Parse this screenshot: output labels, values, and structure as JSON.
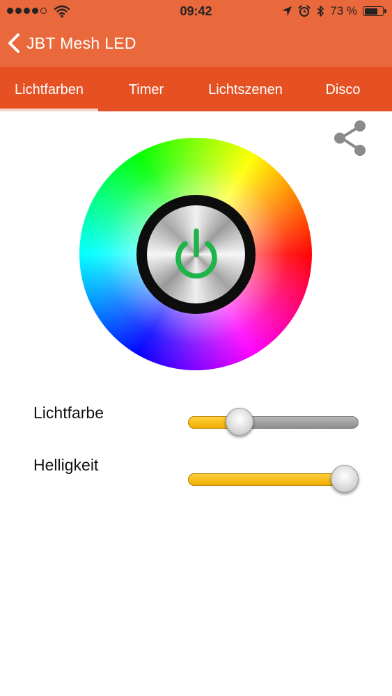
{
  "status": {
    "time": "09:42",
    "battery": "73 %",
    "battery_level": 0.73
  },
  "nav": {
    "title": "JBT Mesh LED"
  },
  "tabs": [
    {
      "label": "Lichtfarben",
      "selected": true
    },
    {
      "label": "Timer",
      "selected": false
    },
    {
      "label": "Lichtszenen",
      "selected": false
    },
    {
      "label": "Disco",
      "selected": false
    }
  ],
  "sliders": {
    "lichtfarbe": {
      "label": "Lichtfarbe",
      "value": 0.3
    },
    "helligkeit": {
      "label": "Helligkeit",
      "value": 0.92
    }
  },
  "colors": {
    "nav_bg": "#E9693C",
    "tab_bg": "#E65124",
    "power_icon": "#1DB44A",
    "slider_fill": "#F7B800"
  },
  "icons": {
    "back": "chevron-left-icon",
    "share": "share-icon",
    "power": "power-icon",
    "wifi": "wifi-icon",
    "location": "location-arrow-icon",
    "alarm": "alarm-clock-icon",
    "bluetooth": "bluetooth-icon",
    "battery": "battery-icon"
  }
}
